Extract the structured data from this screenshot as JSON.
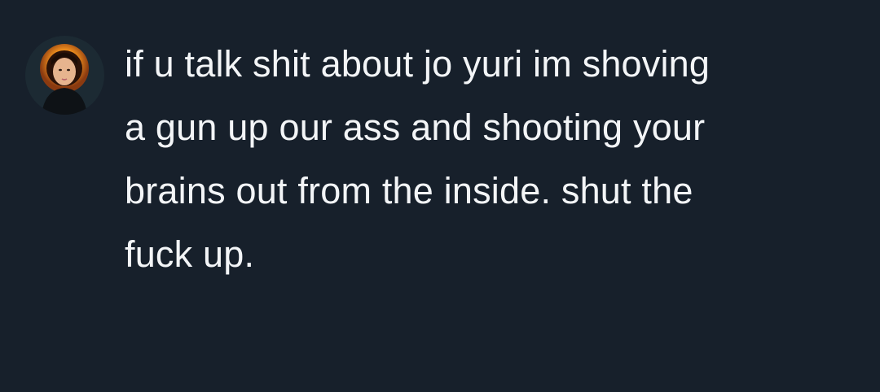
{
  "post": {
    "avatar_icon": "profile-photo",
    "lines": [
      "if u talk shit about jo yuri im shoving",
      "a gun up our ass and shooting your",
      "brains out from the inside. shut the",
      "fuck up."
    ]
  },
  "colors": {
    "background": "#17202b",
    "text": "#f3f5f7",
    "avatar_ring": "#e8a040"
  }
}
